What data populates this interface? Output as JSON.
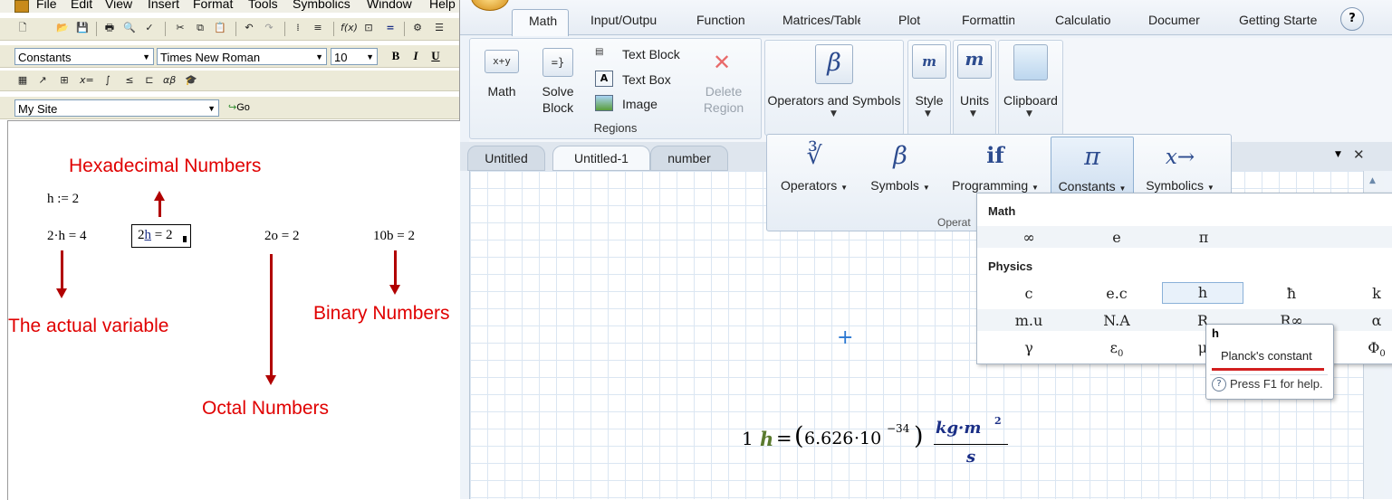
{
  "legacy": {
    "menu": [
      "File",
      "Edit",
      "View",
      "Insert",
      "Format",
      "Tools",
      "Symbolics",
      "Window",
      "Help"
    ],
    "style_combo": "Constants",
    "font_combo": "Times New Roman",
    "size_combo": "10",
    "bold": "B",
    "italic": "I",
    "underline": "U",
    "site_combo": "My Site",
    "go_label": "Go",
    "math": {
      "def": "h := 2",
      "expr1": "2·h = 4",
      "expr2_prefix": "2",
      "expr2_h": "h",
      "expr2_rest": " = 2",
      "expr3": "2o = 2",
      "expr4": "10b = 2"
    },
    "annotations": {
      "hex": "Hexadecimal Numbers",
      "actual": "The actual variable",
      "binary": "Binary Numbers",
      "octal": "Octal Numbers"
    }
  },
  "ribbon": {
    "tabs": [
      "Math",
      "Input/Outpu",
      "Function",
      "Matrices/Table",
      "Plot",
      "Formattin",
      "Calculatio",
      "Documer",
      "Getting Starte"
    ],
    "active_tab": "Math",
    "help_glyph": "?",
    "math_btn": {
      "icon": "x+y",
      "label": "Math"
    },
    "solve_btn": {
      "icon": "=}",
      "label_1": "Solve",
      "label_2": "Block"
    },
    "text_block": "Text Block",
    "text_box": "Text Box",
    "image": "Image",
    "delete_region": {
      "label_1": "Delete",
      "label_2": "Region"
    },
    "regions_group": "Regions",
    "operators_symbols": {
      "icon": "β",
      "label": "Operators and Symbols"
    },
    "style": {
      "icon": "m",
      "label": "Style"
    },
    "units": {
      "icon": "m",
      "label": "Units"
    },
    "clipboard": {
      "label": "Clipboard"
    }
  },
  "doc_tabs": [
    "Untitled",
    "Untitled-1",
    "number"
  ],
  "active_doc": "Untitled-1",
  "palette": {
    "buttons": [
      {
        "sym": "∛",
        "label": "Operators"
      },
      {
        "sym": "β",
        "label": "Symbols"
      },
      {
        "sym": "if",
        "label": "Programming"
      },
      {
        "sym": "π",
        "label": "Constants"
      },
      {
        "sym": "x→",
        "label": "Symbolics"
      }
    ],
    "group_label": "Operat"
  },
  "constants": {
    "math_header": "Math",
    "math_row": [
      "∞",
      "e",
      "π"
    ],
    "physics_header": "Physics",
    "physics_row1": [
      "c",
      "e.c",
      "h",
      "ħ",
      "k"
    ],
    "physics_row2": [
      "m.u",
      "N.A",
      "R",
      "R∞",
      "α"
    ],
    "physics_row3": [
      "γ",
      "ε0",
      "μ",
      "",
      "Φ0"
    ],
    "selected": "h"
  },
  "tooltip": {
    "title": "h",
    "desc": "Planck's constant",
    "help": "Press F1 for help."
  },
  "result": {
    "coef": "1",
    "var": "h",
    "eq": "=",
    "value": "6.626",
    "times": "·10",
    "exp": "−34",
    "unit_num": "kg·m",
    "unit_exp": "2",
    "unit_den": "s"
  },
  "colors": {
    "accent_red": "#e00000",
    "ribbon_blue": "#2d4c8f",
    "result_green": "#5a7a2e",
    "unit_blue": "#1b2f86"
  }
}
